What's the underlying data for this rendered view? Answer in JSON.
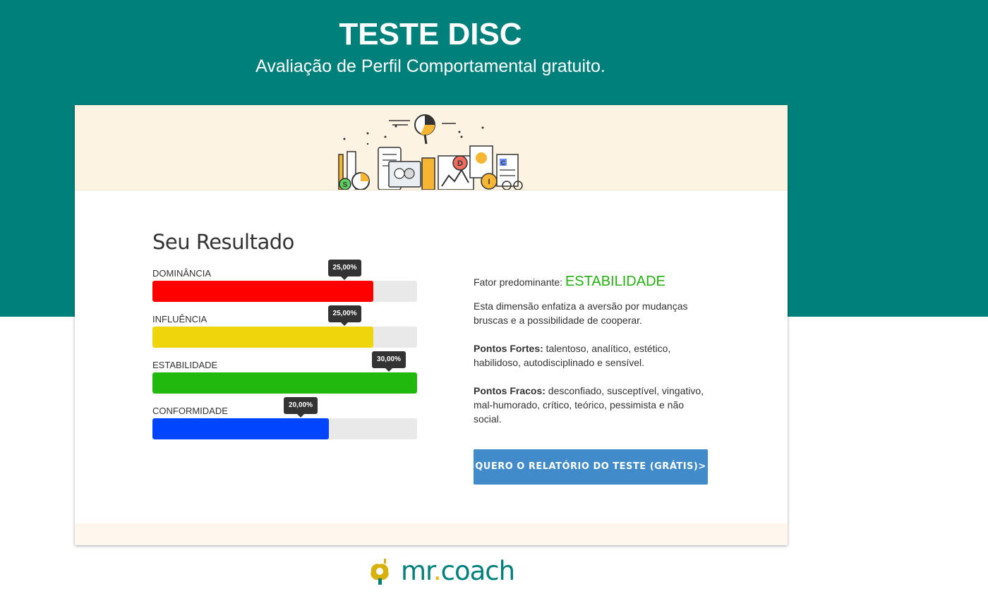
{
  "header": {
    "title": "TESTE DISC",
    "subtitle": "Avaliação de Perfil Comportamental gratuito."
  },
  "result": {
    "title": "Seu Resultado",
    "bars": [
      {
        "label": "DOMINÂNCIA",
        "percent_text": "25,00%",
        "value": 25,
        "color": "#ff0000"
      },
      {
        "label": "INFLUÊNCIA",
        "percent_text": "25,00%",
        "value": 25,
        "color": "#efd60c"
      },
      {
        "label": "ESTABILIDADE",
        "percent_text": "30,00%",
        "value": 30,
        "color": "#22b90f"
      },
      {
        "label": "CONFORMIDADE",
        "percent_text": "20,00%",
        "value": 20,
        "color": "#0046ff"
      }
    ],
    "bar_max": 30
  },
  "summary": {
    "factor_label": "Fator predominante:",
    "factor_value": "ESTABILIDADE",
    "description": "Esta dimensão enfatiza a aversão por mudanças bruscas e a possibilidade de cooperar.",
    "strengths_label": "Pontos Fortes:",
    "strengths_text": "talentoso, analítico, estético, habilidoso, autodisciplinado e sensível.",
    "weaknesses_label": "Pontos Fracos:",
    "weaknesses_text": "desconfiado, susceptível, vingativo, mal-humorado, crítico, teórico, pessimista e não social."
  },
  "cta": {
    "label": "QUERO O RELATÓRIO DO TESTE (GRÁTIS)>"
  },
  "banner": {
    "letters": [
      "D",
      "I",
      "S",
      "C"
    ]
  },
  "footer": {
    "logo_text_main": "mr",
    "logo_text_dot": ".",
    "logo_text_end": "coach"
  }
}
